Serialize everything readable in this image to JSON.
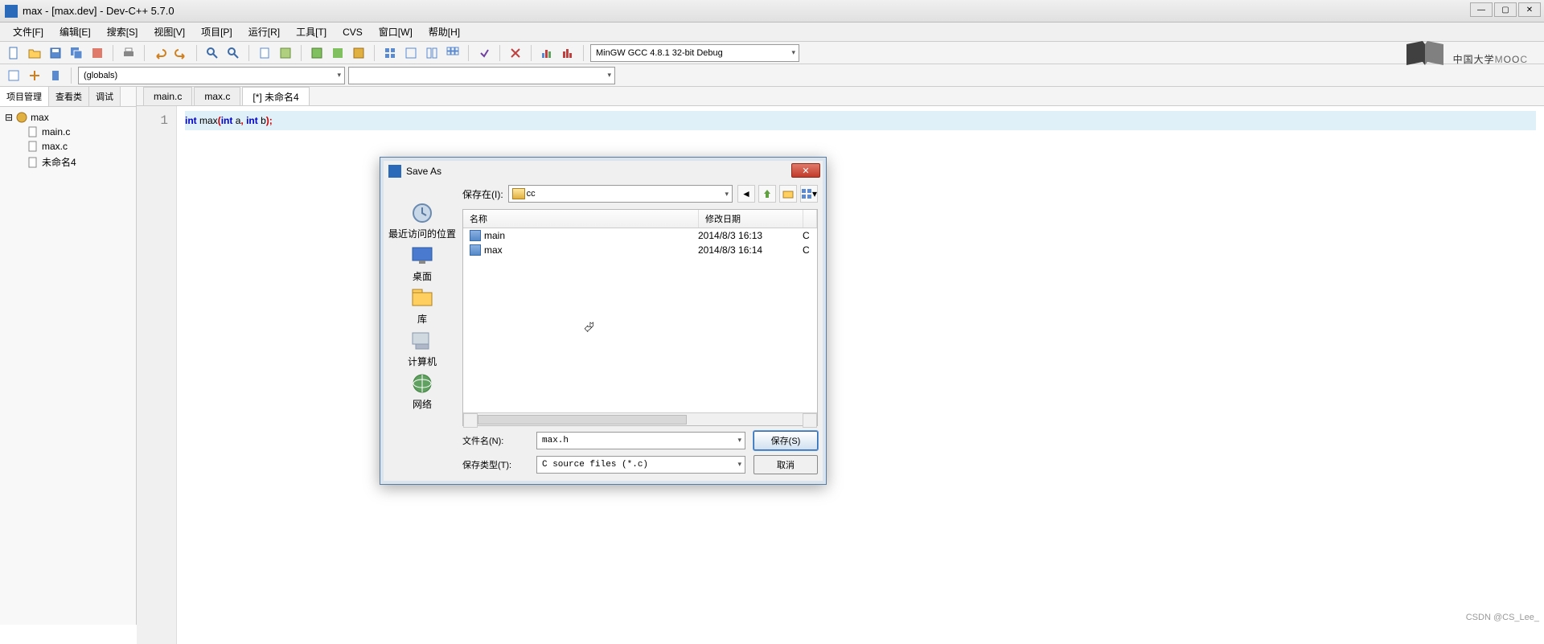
{
  "title": "max - [max.dev] - Dev-C++ 5.7.0",
  "menu": [
    "文件[F]",
    "编辑[E]",
    "搜索[S]",
    "视图[V]",
    "项目[P]",
    "运行[R]",
    "工具[T]",
    "CVS",
    "窗口[W]",
    "帮助[H]"
  ],
  "compiler_combo": "MinGW GCC 4.8.1 32-bit Debug",
  "class_combo": "(globals)",
  "left_tabs": [
    "项目管理",
    "查看类",
    "调试"
  ],
  "tree_root": "max",
  "tree_items": [
    "main.c",
    "max.c",
    "未命名4"
  ],
  "editor_tabs": [
    "main.c",
    "max.c",
    "[*] 未命名4"
  ],
  "code_line_no": "1",
  "dialog": {
    "title": "Save As",
    "loc_label": "保存在(I):",
    "loc_value": "cc",
    "nav": [
      "最近访问的位置",
      "桌面",
      "库",
      "计算机",
      "网络"
    ],
    "columns": [
      "名称",
      "修改日期"
    ],
    "files": [
      {
        "name": "main",
        "date": "2014/8/3 16:13"
      },
      {
        "name": "max",
        "date": "2014/8/3 16:14"
      }
    ],
    "filename_label": "文件名(N):",
    "filename_value": "max.h",
    "filetype_label": "保存类型(T):",
    "filetype_value": "C source files (*.c)",
    "save_btn": "保存(S)",
    "cancel_btn": "取消"
  },
  "watermark": "中国大学MOOC",
  "credit": "CSDN @CS_Lee_"
}
